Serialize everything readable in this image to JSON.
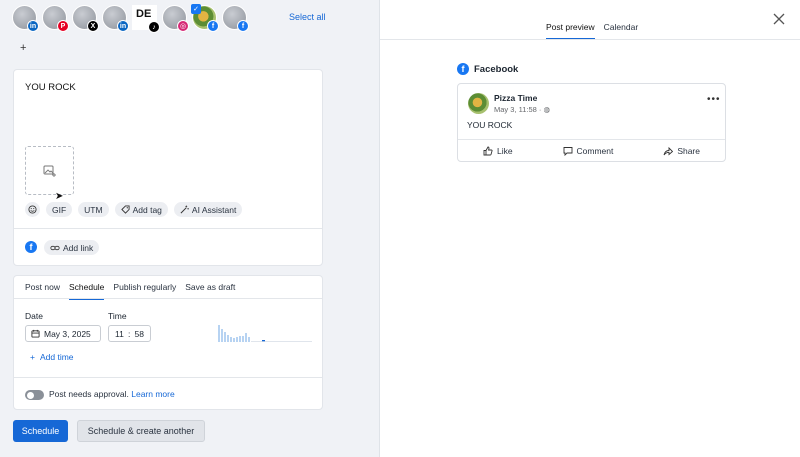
{
  "accounts": [
    {
      "network": "linkedin",
      "badge": "in",
      "color": "#0a66c2"
    },
    {
      "network": "pinterest",
      "badge": "P",
      "color": "#e60023"
    },
    {
      "network": "x",
      "badge": "X",
      "color": "#000000"
    },
    {
      "network": "linkedin",
      "badge": "in",
      "color": "#0a66c2"
    },
    {
      "network": "tiktok",
      "badge": "♪",
      "color": "#000000",
      "label": "DE"
    },
    {
      "network": "instagram",
      "badge": "◎",
      "color": "#d62976"
    },
    {
      "network": "facebook",
      "badge": "f",
      "color": "#1877f2",
      "selected": true
    },
    {
      "network": "facebook",
      "badge": "f",
      "color": "#1877f2"
    }
  ],
  "select_all": "Select all",
  "add_account": "+",
  "composer": {
    "text": "YOU ROCK",
    "tools": {
      "gif": "GIF",
      "utm": "UTM",
      "add_tag": "Add tag",
      "ai": "AI Assistant"
    },
    "add_link": "Add link"
  },
  "schedule": {
    "tabs": [
      "Post now",
      "Schedule",
      "Publish regularly",
      "Save as draft"
    ],
    "active_tab": 1,
    "date_label": "Date",
    "date_value": "May 3, 2025",
    "time_label": "Time",
    "time_hour": "11",
    "time_sep": ":",
    "time_min": "58",
    "add_time": "Add time",
    "approval_text": "Post needs approval.",
    "learn_more": "Learn more"
  },
  "buttons": {
    "schedule": "Schedule",
    "schedule_another": "Schedule & create another"
  },
  "preview": {
    "tabs": [
      "Post preview",
      "Calendar"
    ],
    "network": "Facebook",
    "page_name": "Pizza Time",
    "meta": "May 3, 11:58 ·",
    "text": "YOU ROCK",
    "actions": {
      "like": "Like",
      "comment": "Comment",
      "share": "Share"
    }
  },
  "colors": {
    "accent": "#1668d6",
    "facebook": "#1877f2"
  }
}
